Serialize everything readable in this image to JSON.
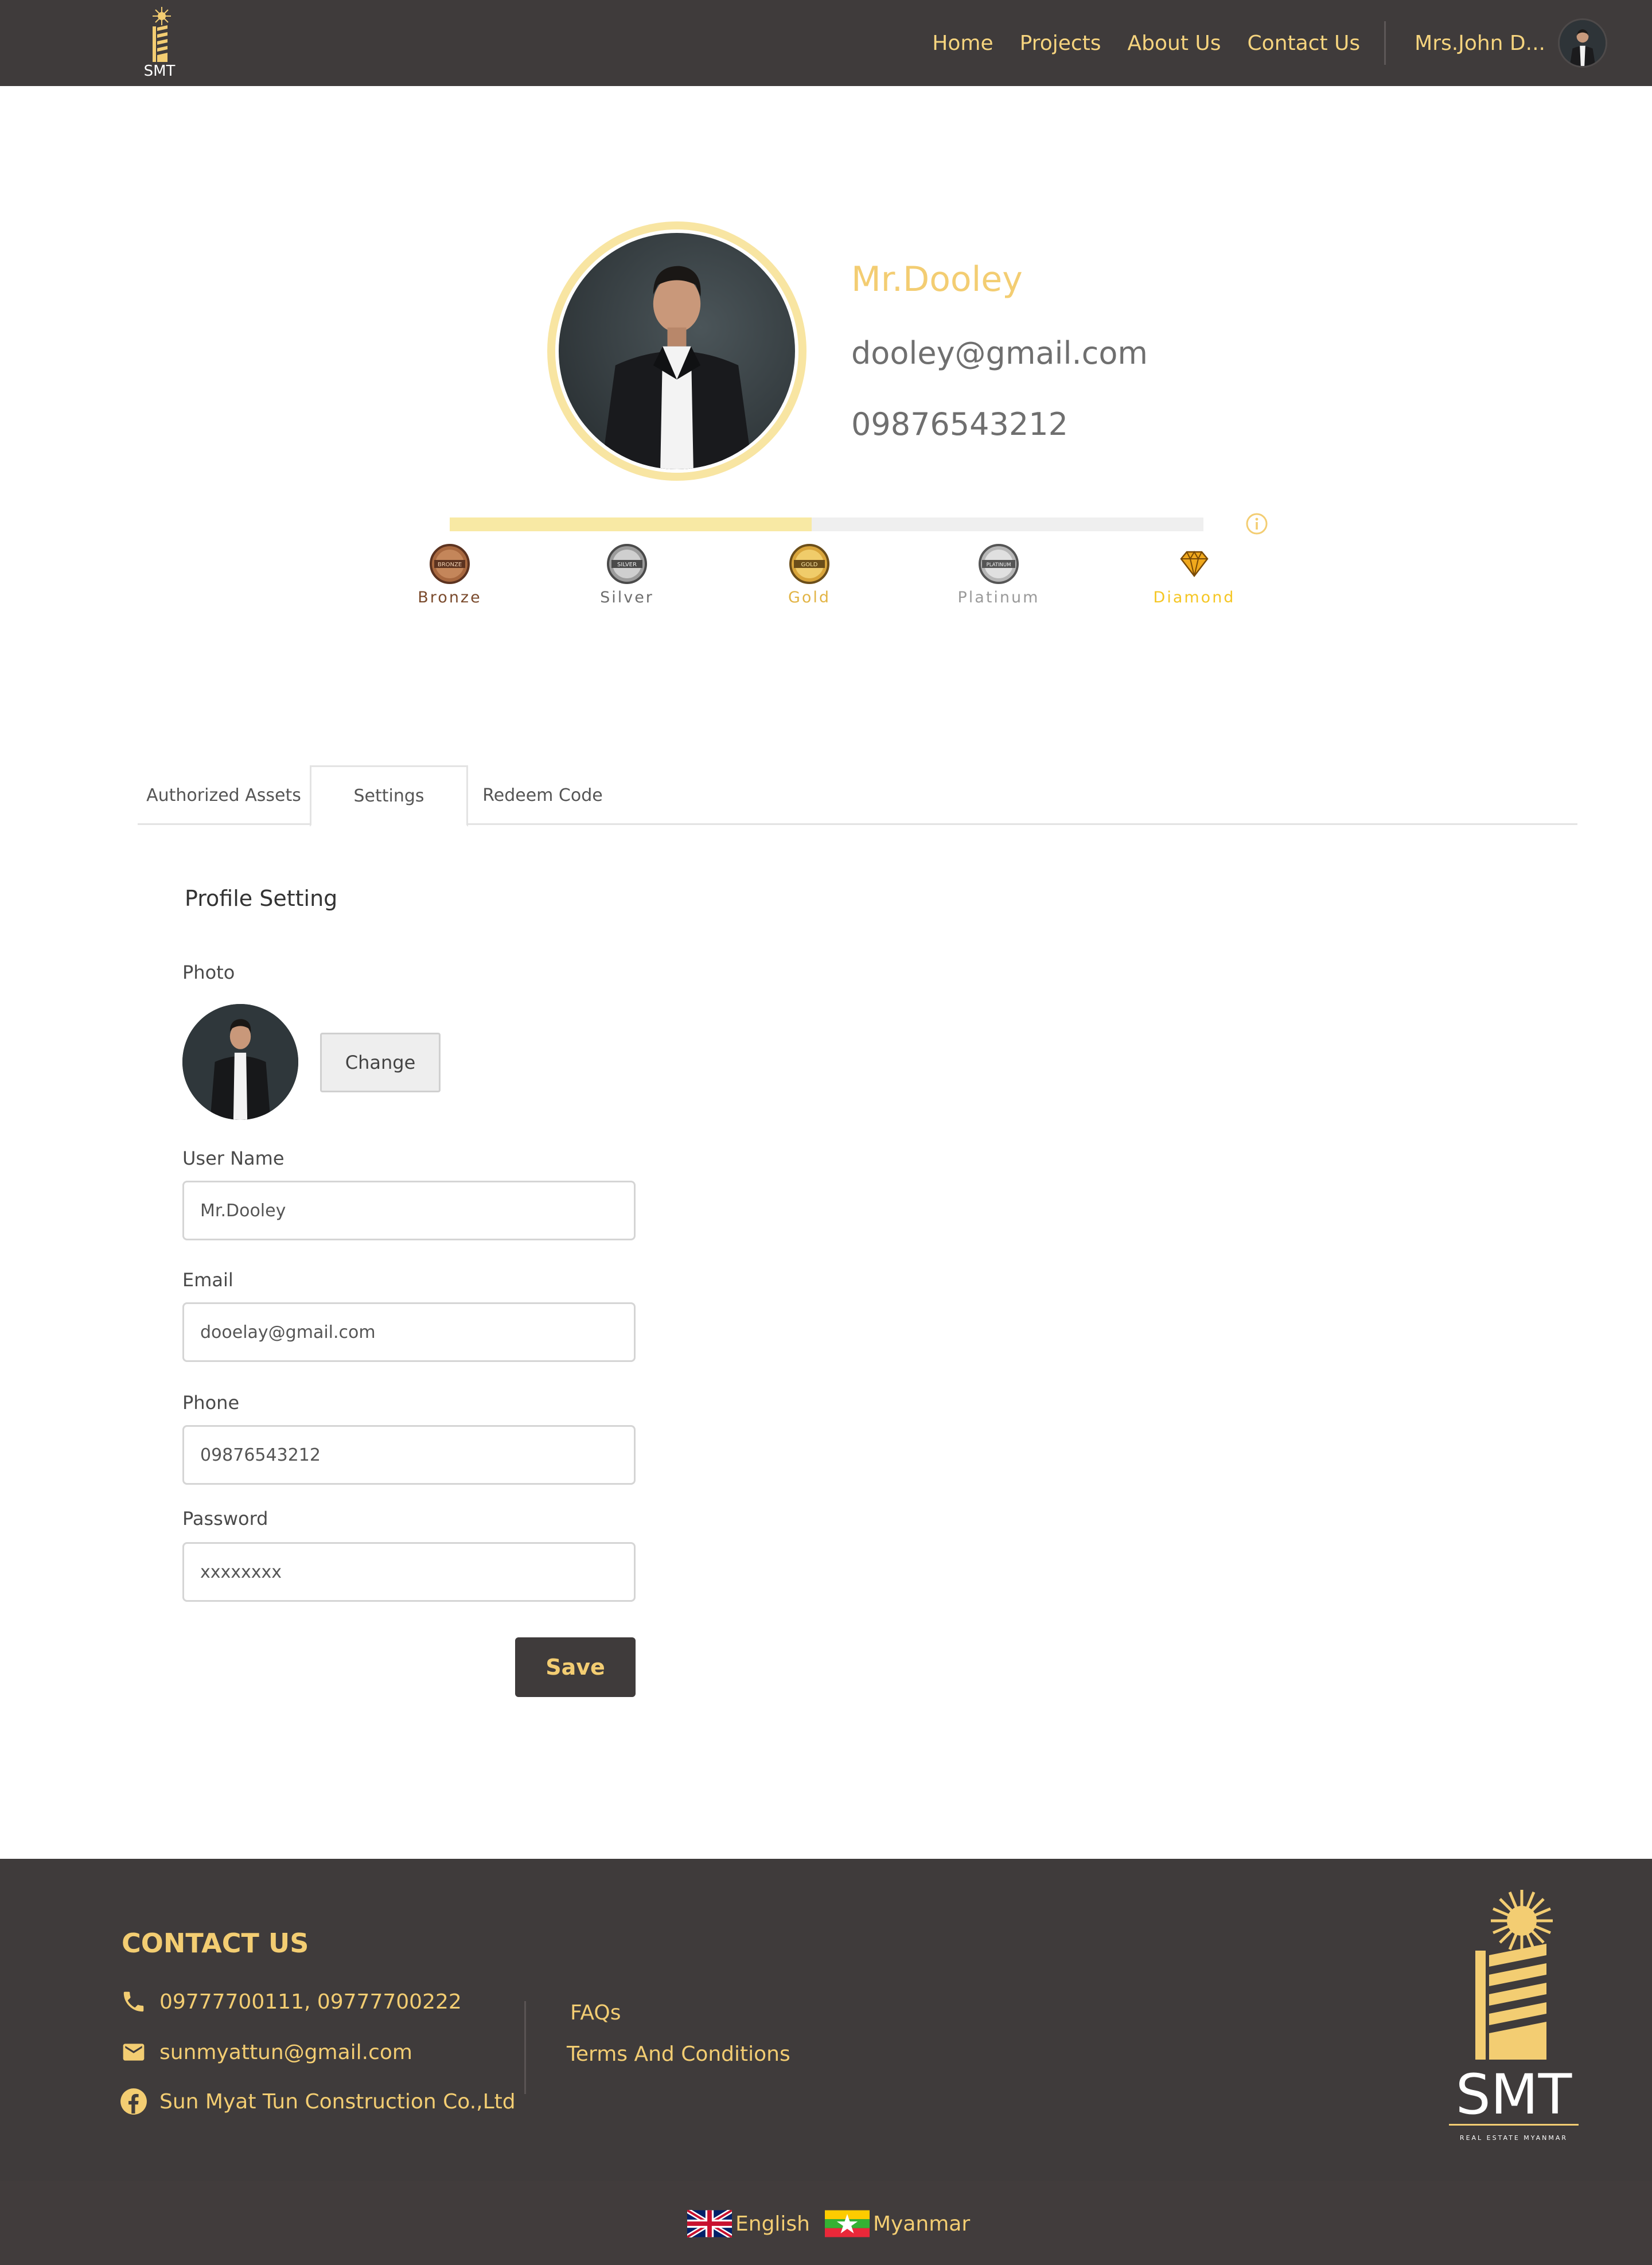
{
  "header": {
    "logo_text": "SMT",
    "nav": [
      "Home",
      "Projects",
      "About Us",
      "Contact Us"
    ],
    "user_name": "Mrs.John D..."
  },
  "profile": {
    "name": "Mr.Dooley",
    "email": "dooley@gmail.com",
    "phone": "09876543212",
    "level_progress": 0.48,
    "tiers": [
      {
        "label": "Bronze",
        "badge_text": "BRONZE",
        "color": "#7a4a2c"
      },
      {
        "label": "Silver",
        "badge_text": "SILVER",
        "color": "#6e6e6e"
      },
      {
        "label": "Gold",
        "badge_text": "GOLD",
        "color": "#e2b445"
      },
      {
        "label": "Platinum",
        "badge_text": "PLATINUM",
        "color": "#9a9a9a"
      },
      {
        "label": "Diamond",
        "badge_text": "",
        "color": "#f5c623"
      }
    ]
  },
  "tabs": [
    "Authorized Assets",
    "Settings",
    "Redeem Code"
  ],
  "active_tab": "Settings",
  "form": {
    "title": "Profile Setting",
    "photo_label": "Photo",
    "change_label": "Change",
    "username_label": "User Name",
    "username_value": "Mr.Dooley",
    "email_label": "Email",
    "email_value": "dooelay@gmail.com",
    "phone_label": "Phone",
    "phone_value": "09876543212",
    "password_label": "Password",
    "password_value": "xxxxxxxx",
    "save_label": "Save"
  },
  "footer": {
    "contact_title": "CONTACT US",
    "phone": "09777700111, 09777700222",
    "email": "sunmyattun@gmail.com",
    "facebook": "Sun Myat Tun Construction Co.,Ltd",
    "links": [
      "FAQs",
      "Terms And Conditions"
    ],
    "logo_text": "SMT",
    "logo_subtext": "REAL ESTATE MYANMAR",
    "languages": [
      "English",
      "Myanmar"
    ]
  },
  "colors": {
    "header_bg": "#3f3b3b",
    "accent": "#f3cd72",
    "progress_fill": "#f8e9a4",
    "progress_track": "#efefef"
  }
}
